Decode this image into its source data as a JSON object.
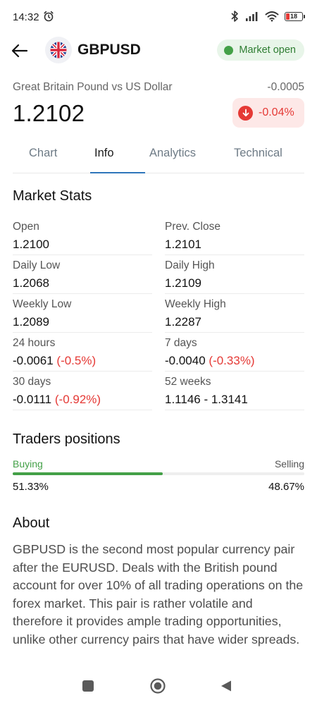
{
  "status_bar": {
    "time": "14:32",
    "battery": "18",
    "icons": [
      "alarm-icon",
      "bluetooth-icon",
      "signal-icon",
      "wifi-icon",
      "battery-icon"
    ]
  },
  "header": {
    "symbol": "GBPUSD",
    "market_status": "Market open",
    "back_icon": "arrow-left-icon",
    "flag_icon": "uk-flag-icon"
  },
  "quote": {
    "pair_name": "Great Britain Pound vs US Dollar",
    "change_abs": "-0.0005",
    "price": "1.2102",
    "change_pct": "-0.04%"
  },
  "tabs": [
    {
      "label": "Chart"
    },
    {
      "label": "Info",
      "active": true
    },
    {
      "label": "Analytics"
    },
    {
      "label": "Technical"
    }
  ],
  "market_stats": {
    "title": "Market Stats",
    "items": [
      {
        "label": "Open",
        "value": "1.2100"
      },
      {
        "label": "Prev. Close",
        "value": "1.2101"
      },
      {
        "label": "Daily Low",
        "value": "1.2068"
      },
      {
        "label": "Daily High",
        "value": "1.2109"
      },
      {
        "label": "Weekly Low",
        "value": "1.2089"
      },
      {
        "label": "Weekly High",
        "value": "1.2287"
      },
      {
        "label": "24 hours",
        "value": "-0.0061",
        "pct": "(-0.5%)"
      },
      {
        "label": "7 days",
        "value": "-0.0040",
        "pct": "(-0.33%)"
      },
      {
        "label": "30 days",
        "value": "-0.0111",
        "pct": "(-0.92%)"
      },
      {
        "label": "52 weeks",
        "value": "1.1146 - 1.3141"
      }
    ]
  },
  "traders": {
    "title": "Traders positions",
    "buying_label": "Buying",
    "selling_label": "Selling",
    "buying_pct": "51.33%",
    "selling_pct": "48.67%",
    "buying_fraction": 0.5133
  },
  "about": {
    "title": "About",
    "text": "GBPUSD is the second most popular currency pair after the EURUSD. Deals with the British pound account for over 10% of all trading operations on the forex market. This pair is rather volatile and therefore it provides ample trading opportunities, unlike other currency pairs that have wider spreads."
  },
  "colors": {
    "accent": "#2f76bb",
    "positive": "#43a047",
    "negative": "#e53935"
  }
}
